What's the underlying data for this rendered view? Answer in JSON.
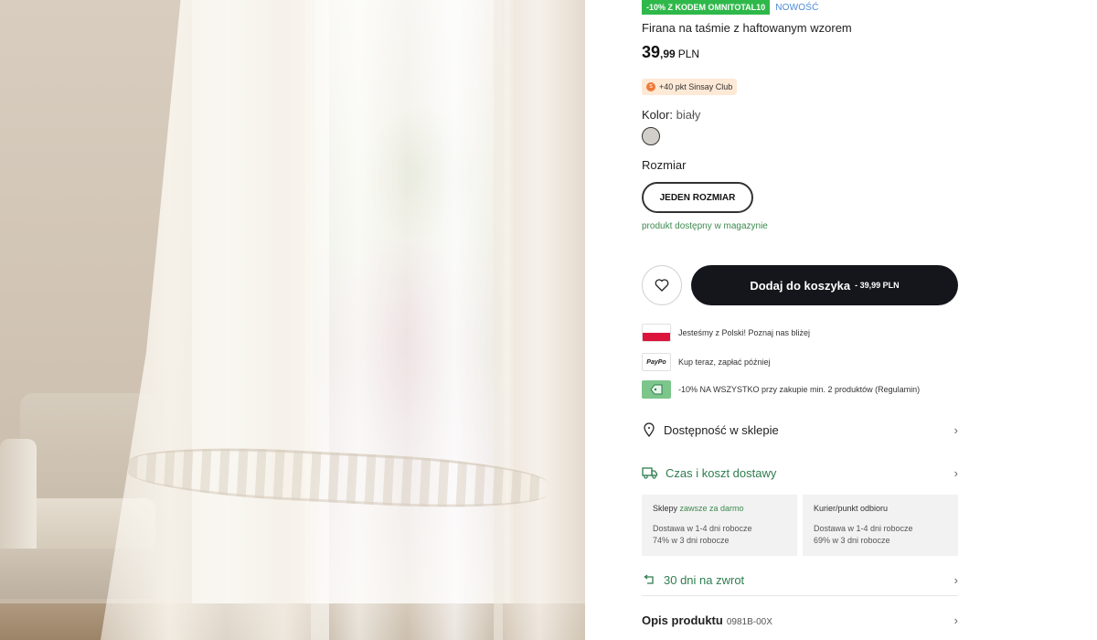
{
  "promo": {
    "code_tag": "-10% Z KODEM OMNITOTAL10",
    "new_tag": "NOWOŚĆ"
  },
  "product": {
    "title": "Firana na taśmie z haftowanym wzorem",
    "price_whole": "39",
    "price_decimal": ",99",
    "currency": "PLN",
    "club_points": "+40 pkt Sinsay Club",
    "color_label": "Kolor:",
    "color_value": "biały",
    "size_label": "Rozmiar",
    "size_option": "JEDEN ROZMIAR",
    "availability": "produkt dostępny w magazynie",
    "code_label": "Opis produktu",
    "code": "0981B-00X"
  },
  "actions": {
    "add_to_cart": "Dodaj do koszyka",
    "add_to_cart_price": "- 39,99 PLN"
  },
  "info": [
    {
      "icon": "poland-flag-icon",
      "text": "Jesteśmy z Polski! Poznaj nas bliżej"
    },
    {
      "icon": "paypo-icon",
      "badge": "PayPo",
      "text": "Kup teraz, zapłać później"
    },
    {
      "icon": "discount-tag-icon",
      "text": "-10% NA WSZYSTKO przy zakupie min. 2 produktów (Regulamin)"
    }
  ],
  "sections": {
    "store_availability": "Dostępność w sklepie",
    "delivery": "Czas i koszt dostawy",
    "returns": "30 dni na zwrot"
  },
  "shipping": [
    {
      "name": "Sklepy",
      "note": "zawsze za darmo",
      "line1": "Dostawa w 1-4 dni robocze",
      "line2": "74% w 3 dni robocze"
    },
    {
      "name": "Kurier/punkt odbioru",
      "note": "",
      "line1": "Dostawa w 1-4 dni robocze",
      "line2": "69% w 3 dni robocze"
    }
  ],
  "colors": {
    "accent_green": "#2fb84a",
    "cart_button": "#15161c",
    "link_green": "#2e7d4f"
  }
}
